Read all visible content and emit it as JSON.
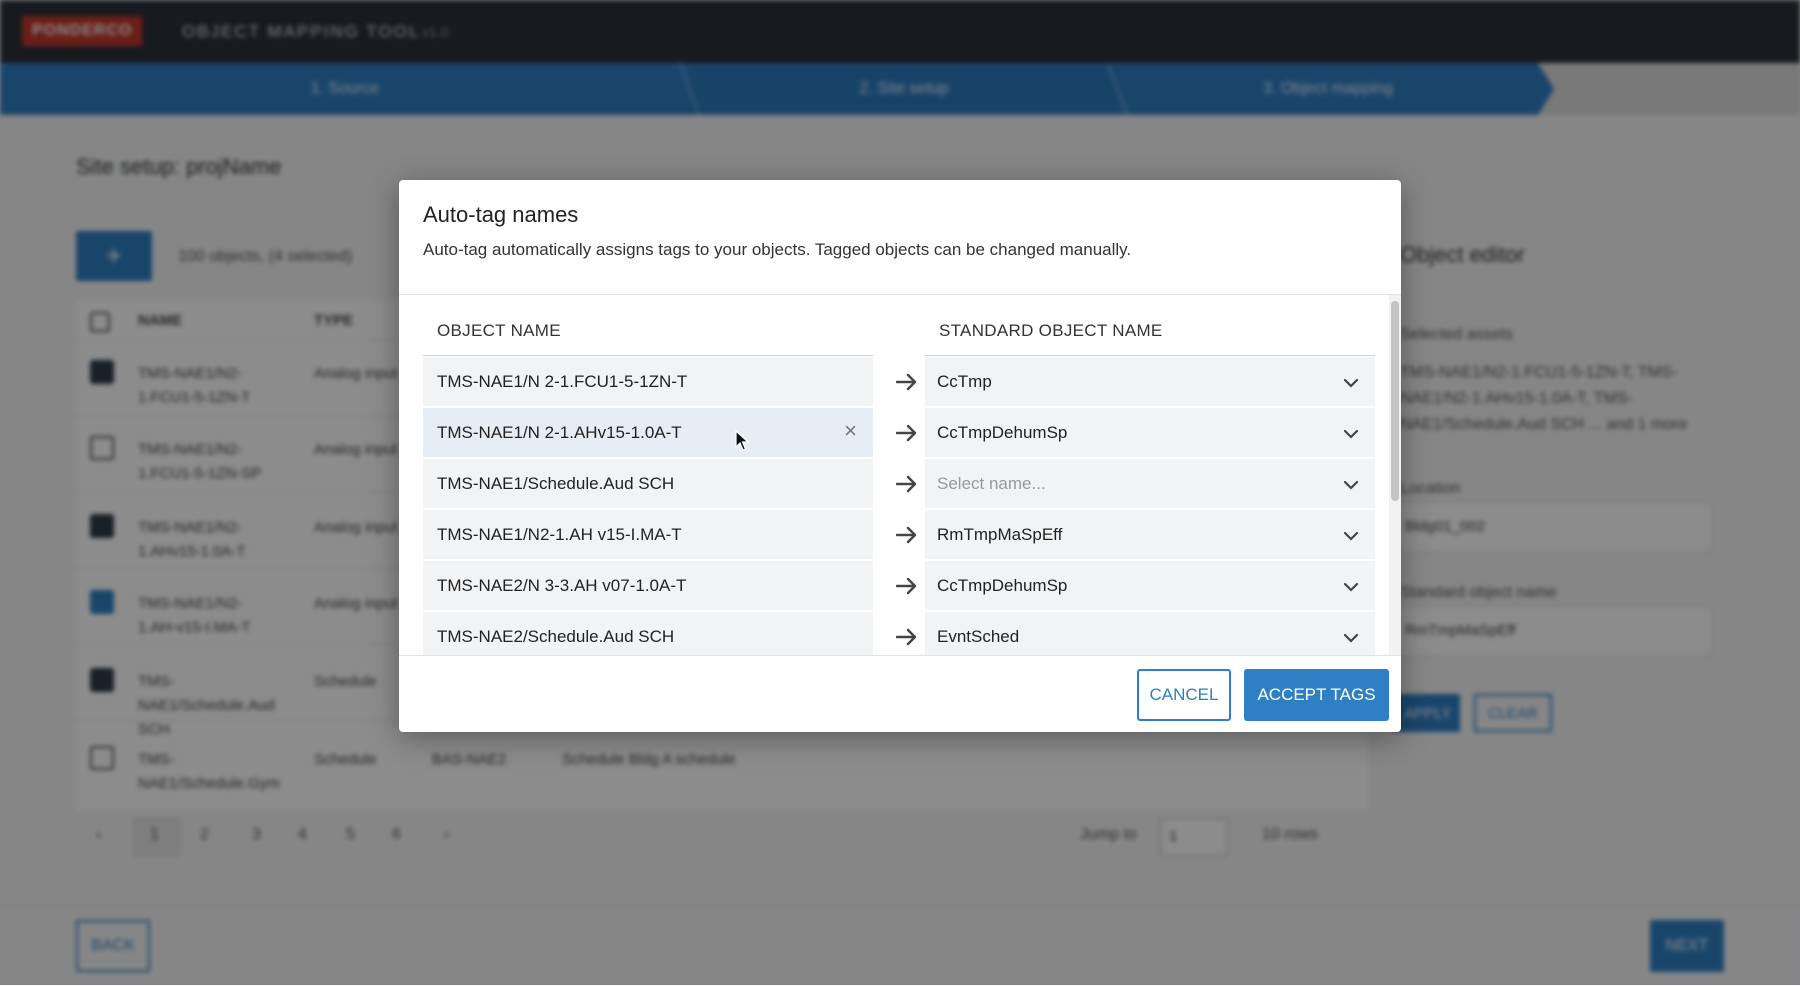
{
  "app": {
    "logo_text": "PONDERCO",
    "title": "OBJECT MAPPING TOOL",
    "version": "v1.0"
  },
  "stepper": {
    "steps": [
      {
        "label": "1. Source"
      },
      {
        "label": "2. Site setup"
      },
      {
        "label": "3. Object mapping"
      }
    ]
  },
  "page": {
    "title": "Site setup: projName",
    "selection_text": "100 objects, (4 selected)",
    "add_label": "+",
    "columns": [
      "NAME",
      "TYPE"
    ],
    "rows": [
      {
        "name": "TMS-NAE1/N2-1.FCU1-5-1ZN-T",
        "type": "Analog input"
      },
      {
        "name": "TMS-NAE1/N2-1.FCU1-5-1ZN-SP",
        "type": "Analog input"
      },
      {
        "name": "TMS-NAE1/N2-1.AHv15-1.0A-T",
        "type": "Analog input"
      },
      {
        "name": "TMS-NAE1/N2-1.AH-v15-I.MA-T",
        "type": "Analog input"
      },
      {
        "name": "TMS-NAE1/Schedule.Aud SCH",
        "type": "Schedule"
      },
      {
        "name": "TMS-NAE1/Schedule.Gym",
        "type": "Schedule",
        "device": "BAS-NAE2",
        "desc": "Schedule Bldg A schedule"
      }
    ],
    "pager": [
      "‹",
      "1",
      "2",
      "3",
      "4",
      "5",
      "6",
      "›"
    ],
    "jump_label": "Jump to",
    "jump_value": "1",
    "rows_label": "10 rows"
  },
  "editor": {
    "title": "Object editor",
    "selected_label": "Selected assets",
    "selected_text": "TMS-NAE1/N2-1.FCU1-5-1ZN-T, TMS-NAE1/N2-1.AHv15-1.0A-T, TMS-NAE1/Schedule.Aud SCH ... and 1 more",
    "location_label": "Location",
    "location_value": "Bldg01_002",
    "std_label": "Standard object name",
    "std_value": "RmTmpMaSpEff",
    "apply_label": "APPLY",
    "clear_label": "CLEAR"
  },
  "footer": {
    "back_label": "BACK",
    "next_label": "NEXT"
  },
  "modal": {
    "title": "Auto-tag names",
    "description": "Auto-tag automatically assigns tags to your objects. Tagged objects can be changed manually.",
    "col_object": "OBJECT NAME",
    "col_standard": "STANDARD OBJECT NAME",
    "placeholder": "Select name...",
    "rows": [
      {
        "object": "TMS-NAE1/N 2-1.FCU1-5-1ZN-T",
        "standard": "CcTmp"
      },
      {
        "object": "TMS-NAE1/N 2-1.AHv15-1.0A-T",
        "standard": "CcTmpDehumSp"
      },
      {
        "object": "TMS-NAE1/Schedule.Aud SCH",
        "standard": ""
      },
      {
        "object": "TMS-NAE1/N2-1.AH v15-I.MA-T",
        "standard": "RmTmpMaSpEff"
      },
      {
        "object": "TMS-NAE2/N 3-3.AH v07-1.0A-T",
        "standard": "CcTmpDehumSp"
      },
      {
        "object": "TMS-NAE2/Schedule.Aud SCH",
        "standard": "EvntSched"
      }
    ],
    "cancel_label": "CANCEL",
    "accept_label": "ACCEPT TAGS"
  },
  "colors": {
    "accent": "#2f7fc4",
    "topbar": "#2b3038"
  }
}
